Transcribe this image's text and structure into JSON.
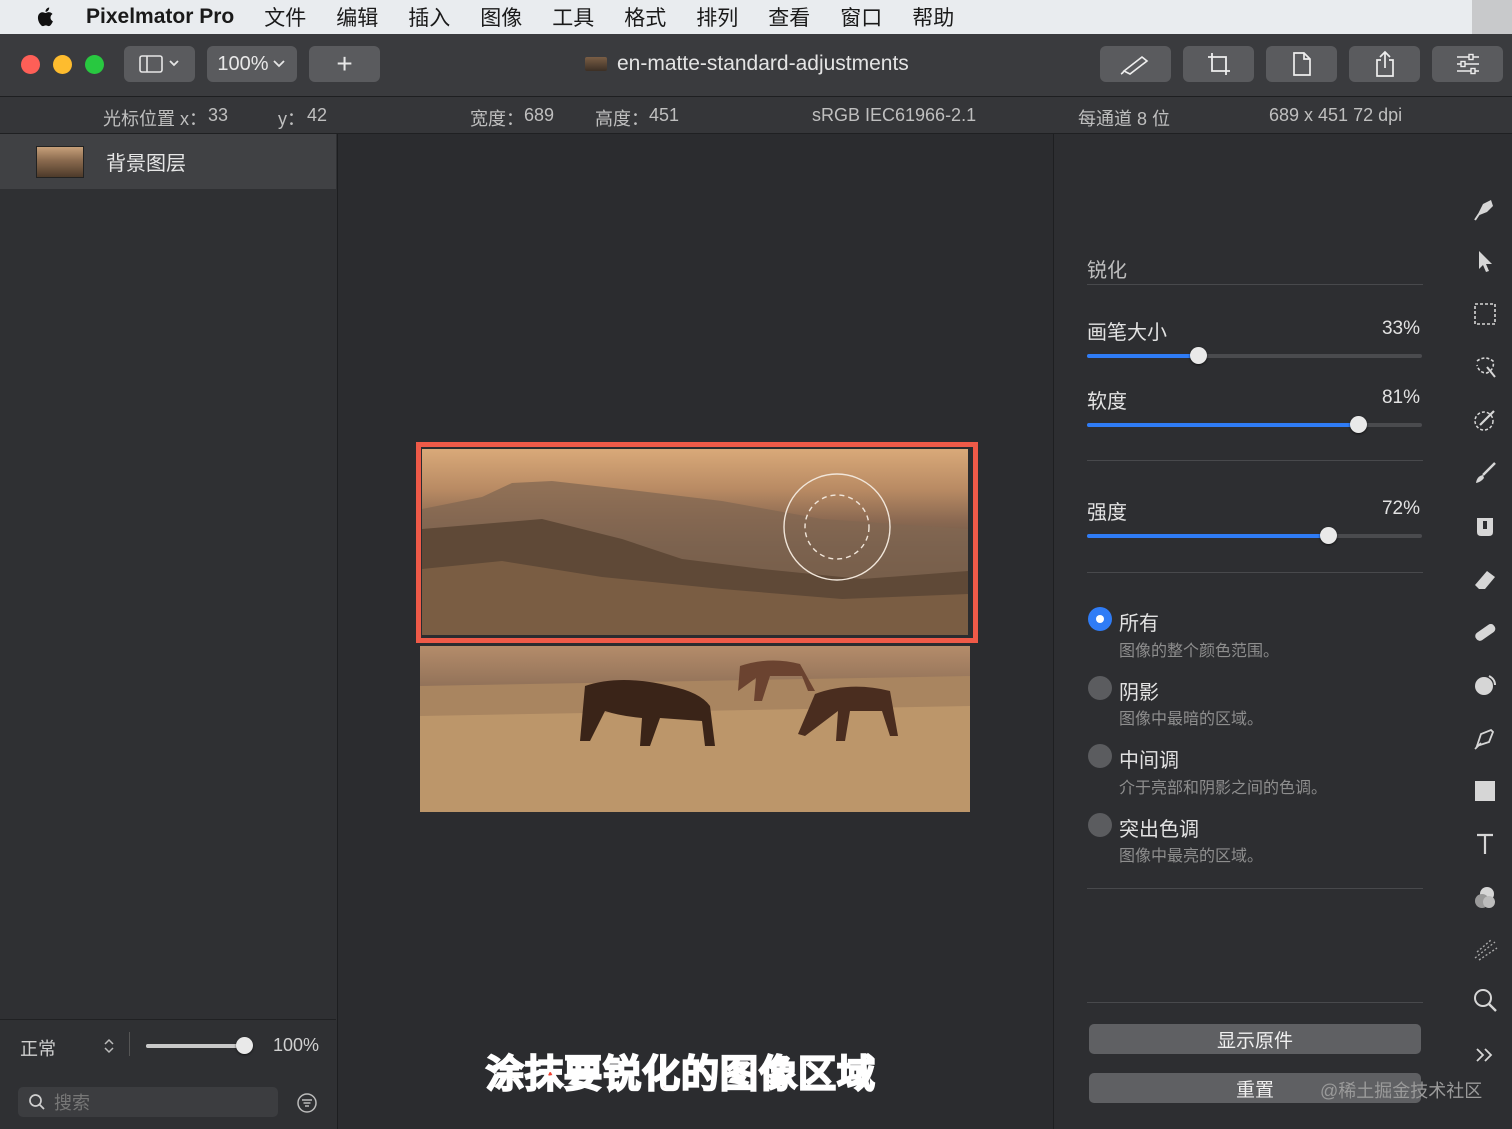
{
  "menubar": {
    "app_name": "Pixelmator Pro",
    "items": [
      "文件",
      "编辑",
      "插入",
      "图像",
      "工具",
      "格式",
      "排列",
      "查看",
      "窗口",
      "帮助"
    ]
  },
  "toolbar": {
    "zoom_label": "100%",
    "add_label": "+",
    "document_title": "en-matte-standard-adjustments"
  },
  "infobar": {
    "cursor_x_label": "光标位置 x：",
    "cursor_x": "33",
    "cursor_y_label": "y：",
    "cursor_y": "42",
    "width_label": "宽度：",
    "width": "689",
    "height_label": "高度：",
    "height": "451",
    "color_profile": "sRGB IEC61966-2.1",
    "bit_depth": "每通道 8 位",
    "dimensions": "689 x 451 72 dpi"
  },
  "layers": {
    "items": [
      {
        "name": "背景图层"
      }
    ],
    "blend_mode": "正常",
    "opacity_value": 1.0,
    "opacity_label": "100%",
    "search_placeholder": "搜索"
  },
  "canvas": {
    "caption": "涂抹要锐化的图像区域",
    "highlight_color": "#ef5a48"
  },
  "panel": {
    "title": "锐化",
    "sliders": [
      {
        "label": "画笔大小",
        "value_label": "33%",
        "value": 0.33
      },
      {
        "label": "软度",
        "value_label": "81%",
        "value": 0.81
      },
      {
        "label": "强度",
        "value_label": "72%",
        "value": 0.72
      }
    ],
    "ranges": [
      {
        "label": "所有",
        "description": "图像的整个颜色范围。",
        "selected": true
      },
      {
        "label": "阴影",
        "description": "图像中最暗的区域。",
        "selected": false
      },
      {
        "label": "中间调",
        "description": "介于亮部和阴影之间的色调。",
        "selected": false
      },
      {
        "label": "突出色调",
        "description": "图像中最亮的区域。",
        "selected": false
      }
    ],
    "show_original_label": "显示原件",
    "reset_label": "重置",
    "accent_color": "#2f7cf6"
  },
  "tools": [
    "paint-brush-style-icon",
    "arrange-pointer-icon",
    "rect-selection-icon",
    "magic-selection-icon",
    "color-picker-icon",
    "brush-icon",
    "fill-icon",
    "eraser-icon",
    "repair-icon",
    "distort-icon",
    "pen-icon",
    "shape-icon",
    "text-icon",
    "color-adjust-icon",
    "effects-icon",
    "zoom-icon",
    "more-tools-icon"
  ],
  "watermark": "@稀土掘金技术社区"
}
